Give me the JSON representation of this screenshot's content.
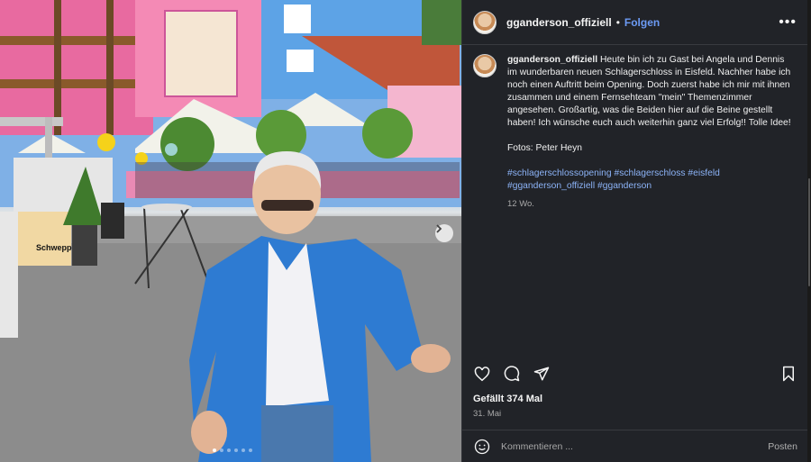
{
  "post": {
    "username": "gganderson_offiziell",
    "separator": "•",
    "follow_label": "Folgen",
    "more_label": "•••",
    "caption_user": "gganderson_offiziell",
    "caption_text": "Heute bin ich zu Gast bei Angela und Dennis im wunderbaren neuen Schlagerschloss in Eisfeld. Nachher habe ich noch einen Auftritt beim Opening. Doch zuerst habe ich mir mit ihnen zusammen und einem Fernsehteam \"mein\" Themenzimmer angesehen. Großartig, was die Beiden hier auf die Beine gestellt haben! Ich wünsche euch auch weiterhin ganz viel Erfolg!! Tolle Idee!",
    "photo_credit": "Fotos: Peter Heyn",
    "hashtags": [
      "#schlagerschlossopening",
      "#schlagerschloss",
      "#eisfeld",
      "#gganderson_offiziell",
      "#gganderson"
    ],
    "caption_age": "12 Wo.",
    "likes_text": "Gefällt 374 Mal",
    "date_text": "31. Mai",
    "comment_placeholder": "Kommentieren ...",
    "post_label": "Posten"
  },
  "media": {
    "carousel_count": 6,
    "carousel_active": 1,
    "sign_text": "Schweppes"
  },
  "icons": {
    "like": "heart-icon",
    "comment": "speech-bubble-icon",
    "share": "paper-plane-icon",
    "save": "bookmark-icon",
    "emoji": "smiley-icon",
    "next": "chevron-right-icon"
  },
  "colors": {
    "panel_bg": "#212328",
    "link": "#6c9bf5",
    "hashtag": "#8cb3f7"
  }
}
